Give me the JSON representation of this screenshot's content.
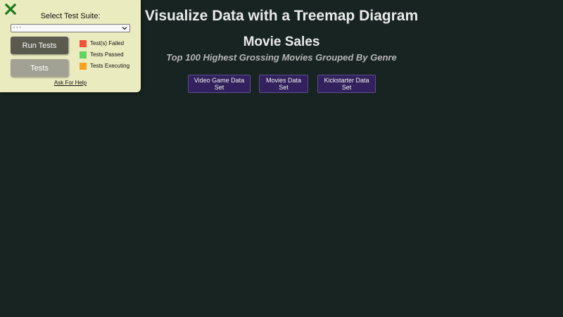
{
  "main": {
    "title": "Visualize Data with a Treemap Diagram",
    "chart_title": "Movie Sales",
    "description": "Top 100 Highest Grossing Movies Grouped By Genre",
    "dataset_buttons": [
      {
        "label": "Video Game Data Set"
      },
      {
        "label": "Movies Data Set"
      },
      {
        "label": "Kickstarter Data Set"
      }
    ]
  },
  "test_panel": {
    "close_icon": "close-x-icon",
    "suite_label": "Select Test Suite:",
    "suite_selected": "- - -",
    "run_button": "Run Tests",
    "tests_button": "Tests",
    "legend": [
      {
        "label": "Test(s) Failed",
        "color": "#f2543a"
      },
      {
        "label": "Tests Passed",
        "color": "#5fd35b"
      },
      {
        "label": "Tests Executing",
        "color": "#f6a21e"
      }
    ],
    "help_link": "Ask For Help"
  },
  "colors": {
    "background": "#172421",
    "panel": "#ebebc0",
    "button_primary": "#32215c"
  }
}
